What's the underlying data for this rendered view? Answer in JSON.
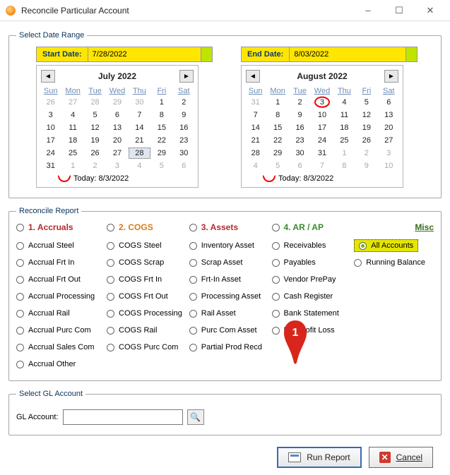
{
  "window": {
    "title": "Reconcile Particular Account",
    "minimize": "–",
    "maximize": "☐",
    "close": "✕"
  },
  "dateRange": {
    "legend": "Select Date Range",
    "start": {
      "label": "Start Date:",
      "value": "7/28/2022"
    },
    "end": {
      "label": "End Date:",
      "value": "8/03/2022"
    },
    "todayText": "Today: 8/3/2022",
    "dows": [
      "Sun",
      "Mon",
      "Tue",
      "Wed",
      "Thu",
      "Fri",
      "Sat"
    ],
    "leftCal": {
      "month": "July 2022",
      "days": [
        {
          "n": "26",
          "other": true
        },
        {
          "n": "27",
          "other": true
        },
        {
          "n": "28",
          "other": true
        },
        {
          "n": "29",
          "other": true
        },
        {
          "n": "30",
          "other": true
        },
        {
          "n": "1"
        },
        {
          "n": "2"
        },
        {
          "n": "3"
        },
        {
          "n": "4"
        },
        {
          "n": "5"
        },
        {
          "n": "6"
        },
        {
          "n": "7"
        },
        {
          "n": "8"
        },
        {
          "n": "9"
        },
        {
          "n": "10"
        },
        {
          "n": "11"
        },
        {
          "n": "12"
        },
        {
          "n": "13"
        },
        {
          "n": "14"
        },
        {
          "n": "15"
        },
        {
          "n": "16"
        },
        {
          "n": "17"
        },
        {
          "n": "18"
        },
        {
          "n": "19"
        },
        {
          "n": "20"
        },
        {
          "n": "21"
        },
        {
          "n": "22"
        },
        {
          "n": "23"
        },
        {
          "n": "24"
        },
        {
          "n": "25"
        },
        {
          "n": "26"
        },
        {
          "n": "27"
        },
        {
          "n": "28",
          "sel": true
        },
        {
          "n": "29"
        },
        {
          "n": "30"
        },
        {
          "n": "31"
        },
        {
          "n": "1",
          "other": true
        },
        {
          "n": "2",
          "other": true
        },
        {
          "n": "3",
          "other": true
        },
        {
          "n": "4",
          "other": true
        },
        {
          "n": "5",
          "other": true
        },
        {
          "n": "6",
          "other": true
        }
      ]
    },
    "rightCal": {
      "month": "August 2022",
      "days": [
        {
          "n": "31",
          "other": true
        },
        {
          "n": "1"
        },
        {
          "n": "2"
        },
        {
          "n": "3",
          "circ": true
        },
        {
          "n": "4"
        },
        {
          "n": "5"
        },
        {
          "n": "6"
        },
        {
          "n": "7"
        },
        {
          "n": "8"
        },
        {
          "n": "9"
        },
        {
          "n": "10"
        },
        {
          "n": "11"
        },
        {
          "n": "12"
        },
        {
          "n": "13"
        },
        {
          "n": "14"
        },
        {
          "n": "15"
        },
        {
          "n": "16"
        },
        {
          "n": "17"
        },
        {
          "n": "18"
        },
        {
          "n": "19"
        },
        {
          "n": "20"
        },
        {
          "n": "21"
        },
        {
          "n": "22"
        },
        {
          "n": "23"
        },
        {
          "n": "24"
        },
        {
          "n": "25"
        },
        {
          "n": "26"
        },
        {
          "n": "27"
        },
        {
          "n": "28"
        },
        {
          "n": "29"
        },
        {
          "n": "30"
        },
        {
          "n": "31"
        },
        {
          "n": "1",
          "other": true
        },
        {
          "n": "2",
          "other": true
        },
        {
          "n": "3",
          "other": true
        },
        {
          "n": "4",
          "other": true
        },
        {
          "n": "5",
          "other": true
        },
        {
          "n": "6",
          "other": true
        },
        {
          "n": "7",
          "other": true
        },
        {
          "n": "8",
          "other": true
        },
        {
          "n": "9",
          "other": true
        },
        {
          "n": "10",
          "other": true
        }
      ]
    }
  },
  "report": {
    "legend": "Reconcile Report",
    "miscLabel": "Misc",
    "heads": [
      "1. Accruals",
      "2. COGS",
      "3. Assets",
      "4. AR / AP"
    ],
    "col1": [
      "Accrual Steel",
      "Accrual Frt In",
      "Accrual Frt Out",
      "Accrual Processing",
      "Accrual Rail",
      "Accrual Purc Com",
      "Accrual Sales Com",
      "Accrual Other"
    ],
    "col2": [
      "COGS Steel",
      "COGS Scrap",
      "COGS Frt In",
      "COGS Frt Out",
      "COGS Processing",
      "COGS Rail",
      "COGS Purc Com"
    ],
    "col3": [
      "Inventory Asset",
      "Scrap Asset",
      "Frt-In Asset",
      "Processing Asset",
      "Rail Asset",
      "Purc Com Asset",
      "Partial Prod Recd"
    ],
    "col4": [
      "Receivables",
      "Payables",
      "Vendor PrePay",
      "Cash Register",
      "Bank Statement",
      "Net Profit Loss"
    ],
    "col5": [
      "All Accounts",
      "Running Balance"
    ],
    "selected": "All Accounts"
  },
  "gl": {
    "legend": "Select GL Account",
    "label": "GL Account:",
    "value": ""
  },
  "buttons": {
    "run": "Run Report",
    "cancel": "Cancel"
  },
  "annotation": {
    "markerText": "1"
  }
}
